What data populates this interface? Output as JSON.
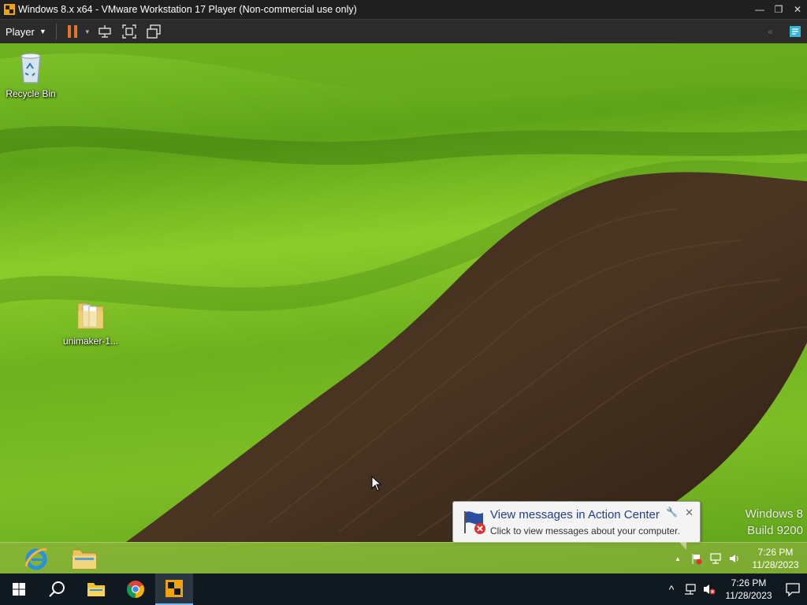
{
  "window": {
    "title": "Windows 8.x x64 - VMware Workstation 17 Player (Non-commercial use only)",
    "controls": {
      "minimize": "—",
      "restore": "❐",
      "close": "✕"
    }
  },
  "toolbar": {
    "player_label": "Player",
    "buttons": [
      "pause-icon",
      "send-ctrl-alt-del-icon",
      "fullscreen-icon",
      "unity-icon"
    ],
    "accent": "#e8722a"
  },
  "desktop": {
    "icons": [
      {
        "label": "Recycle Bin"
      },
      {
        "label": "unimaker-1..."
      }
    ],
    "watermark": {
      "line1": "Windows 8",
      "line2": "Build 9200"
    }
  },
  "notification": {
    "title": "View messages in Action Center",
    "text": "Click to view messages about your computer.",
    "close": "✕"
  },
  "guest_taskbar": {
    "pinned": [
      "internet-explorer-icon",
      "file-explorer-icon"
    ],
    "clock": {
      "time": "7:26 PM",
      "date": "11/28/2023"
    },
    "tray": {
      "overflow": "▲"
    }
  },
  "host_taskbar": {
    "pinned": [
      "start-icon",
      "search-icon",
      "file-explorer-icon",
      "chrome-icon",
      "vmware-icon"
    ],
    "clock": {
      "time": "7:26 PM",
      "date": "11/28/2023"
    },
    "tray": {
      "overflow": "^"
    }
  }
}
